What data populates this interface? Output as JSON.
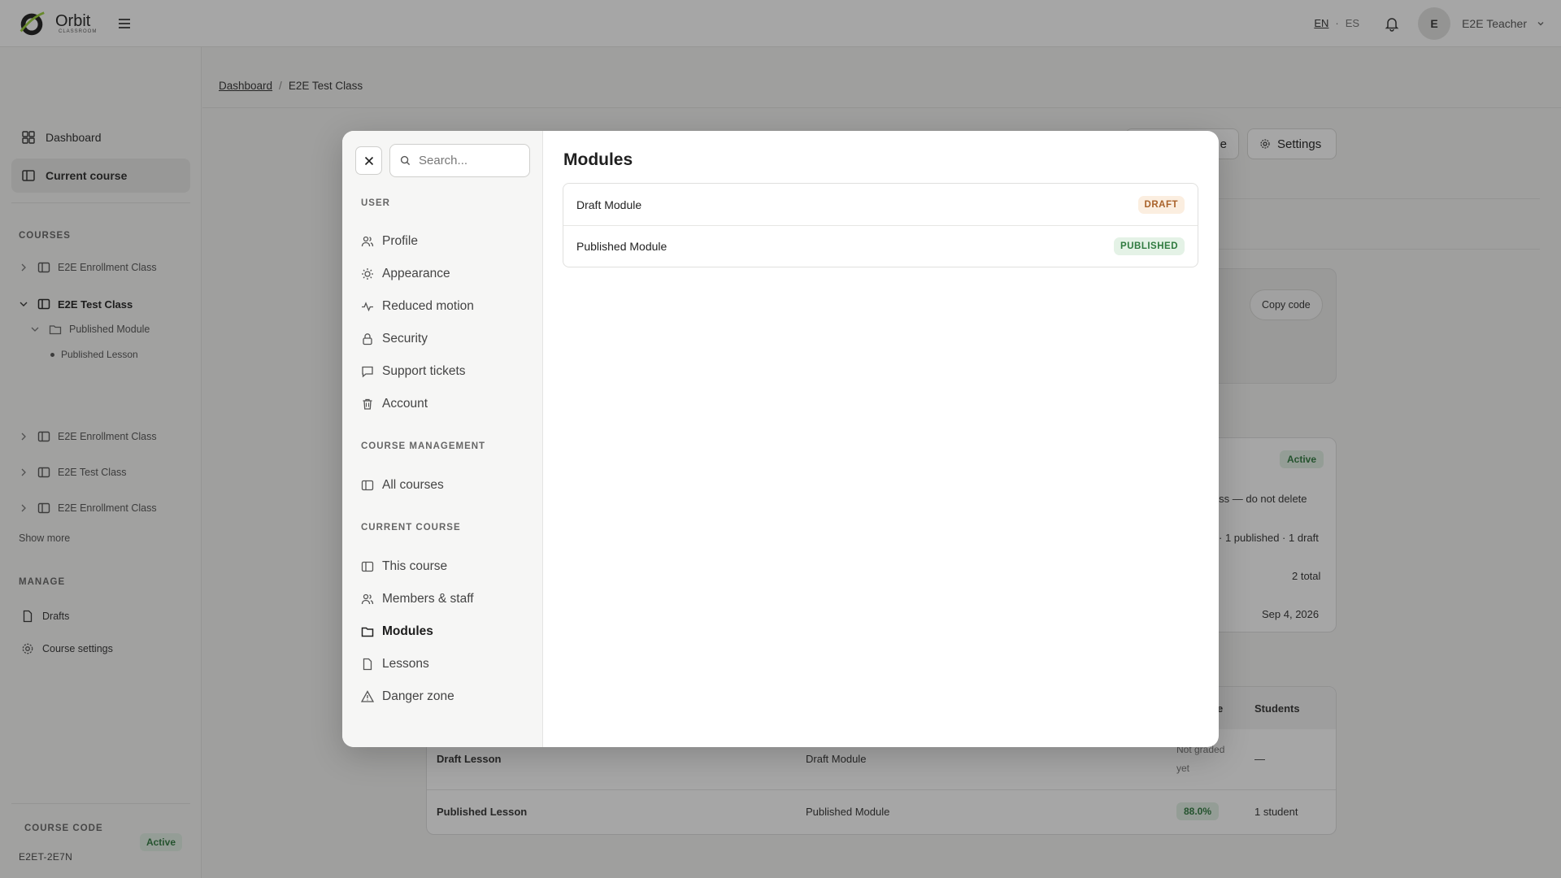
{
  "app": {
    "name": "Orbit",
    "sub": "CLASSROOM"
  },
  "topbar": {
    "lang_en": "EN",
    "lang_sep": "·",
    "lang_es": "ES",
    "avatar_initial": "E",
    "user_name": "E2E Teacher"
  },
  "sidebar": {
    "dashboard": "Dashboard",
    "current_course": "Current course",
    "courses_heading": "COURSES",
    "tree": [
      {
        "label": "E2E Enrollment Class"
      },
      {
        "label": "E2E Test Class"
      },
      {
        "label": "Published Module"
      },
      {
        "label": "Published Lesson"
      },
      {
        "label": "E2E Enrollment Class"
      },
      {
        "label": "E2E Test Class"
      },
      {
        "label": "E2E Enrollment Class"
      }
    ],
    "show_more": "Show more",
    "manage_heading": "MANAGE",
    "drafts": "Drafts",
    "course_settings": "Course settings",
    "course_code_heading": "COURSE CODE",
    "course_code_value": "E2ET-2E7N",
    "course_code_status": "Active"
  },
  "main": {
    "breadcrumb": {
      "root": "Dashboard",
      "sep": "/",
      "current": "E2E Test Class"
    },
    "settings_label": "Settings",
    "partial_button_label": "e",
    "copy_code": "Copy code",
    "info_status": "Active",
    "info_desc": "lass — do not delete",
    "info_lessons": "· 1 published · 1 draft",
    "info_members": "2 total",
    "info_date": "Sep 4, 2026",
    "table_headers": {
      "grade": "de",
      "students": "Students"
    },
    "table_rows": [
      {
        "lesson": "Draft Lesson",
        "module": "Draft Module",
        "grade_line1": "Not graded",
        "grade_line2": "yet",
        "students": "—"
      },
      {
        "lesson": "Published Lesson",
        "module": "Published Module",
        "grade": "88.0%",
        "students": "1 student"
      }
    ]
  },
  "modal": {
    "search_placeholder": "Search...",
    "user_heading": "USER",
    "user_items": [
      "Profile",
      "Appearance",
      "Reduced motion",
      "Security",
      "Support tickets",
      "Account"
    ],
    "course_mgmt_heading": "COURSE MANAGEMENT",
    "course_mgmt_items": [
      "All courses"
    ],
    "current_course_heading": "CURRENT COURSE",
    "current_course_items": [
      "This course",
      "Members & staff",
      "Modules",
      "Lessons",
      "Danger zone"
    ],
    "title": "Modules",
    "modules": [
      {
        "name": "Draft Module",
        "status": "DRAFT"
      },
      {
        "name": "Published Module",
        "status": "PUBLISHED"
      }
    ]
  },
  "colors": {
    "draft": "#a9622a",
    "published": "#2f7a3f",
    "overlay": "rgba(20,20,20,0.38)"
  }
}
